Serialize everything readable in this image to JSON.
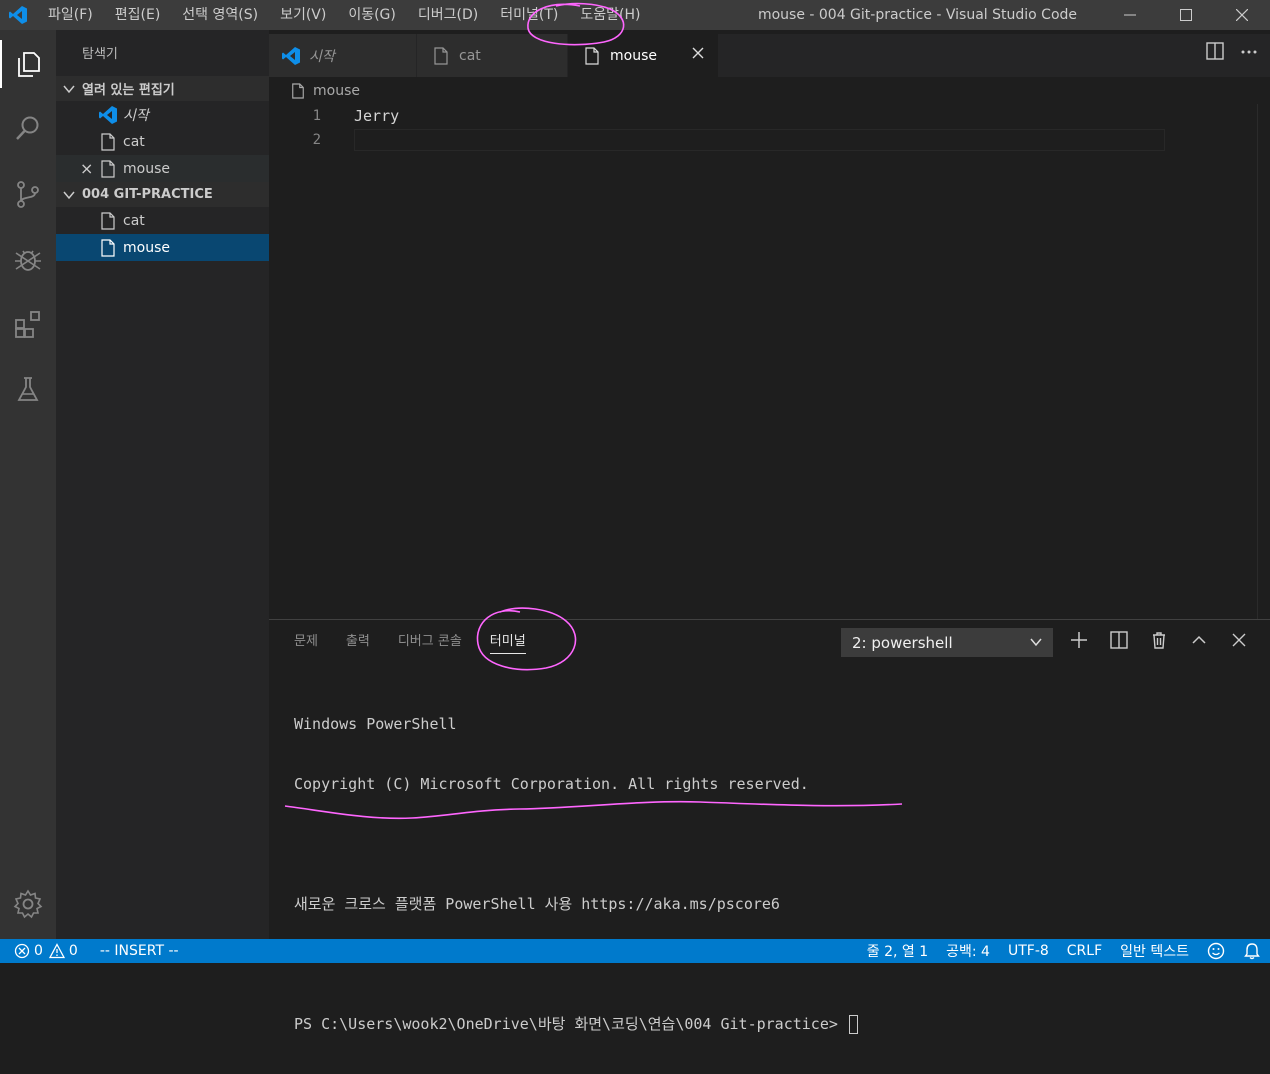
{
  "window": {
    "title": "mouse - 004 Git-practice - Visual Studio Code",
    "menu": [
      "파일(F)",
      "편집(E)",
      "선택 영역(S)",
      "보기(V)",
      "이동(G)",
      "디버그(D)",
      "터미널(T)",
      "도움말(H)"
    ]
  },
  "activitybar": {
    "icons": [
      "explorer-icon",
      "search-icon",
      "source-control-icon",
      "debug-icon",
      "extensions-icon",
      "test-flask-icon"
    ],
    "bottom_icon": "gear-icon"
  },
  "sidebar": {
    "title": "탐색기",
    "open_editors": {
      "header": "열려 있는 편집기",
      "items": [
        {
          "label": "시작",
          "icon": "vscode-icon"
        },
        {
          "label": "cat",
          "icon": "file-icon"
        },
        {
          "label": "mouse",
          "icon": "file-icon",
          "close": "×"
        }
      ]
    },
    "folder": {
      "header": "004 GIT-PRACTICE",
      "items": [
        {
          "label": "cat",
          "icon": "file-icon"
        },
        {
          "label": "mouse",
          "icon": "file-icon"
        }
      ]
    }
  },
  "tabs": [
    {
      "label": "시작",
      "icon": "vscode-icon"
    },
    {
      "label": "cat",
      "icon": "file-icon"
    },
    {
      "label": "mouse",
      "icon": "file-icon",
      "active": true
    }
  ],
  "breadcrumb": "mouse",
  "editor": {
    "lines": [
      {
        "num": "1",
        "text": "Jerry"
      },
      {
        "num": "2",
        "text": ""
      }
    ]
  },
  "panel": {
    "tabs": [
      "문제",
      "출력",
      "디버그 콘솔",
      "터미널"
    ],
    "active_tab": "터미널",
    "terminal_select": "2: powershell",
    "terminal_lines": [
      "Windows PowerShell",
      "Copyright (C) Microsoft Corporation. All rights reserved.",
      "",
      "새로운 크로스 플랫폼 PowerShell 사용 https://aka.ms/pscore6",
      "",
      "PS C:\\Users\\wook2\\OneDrive\\바탕 화면\\코딩\\연습\\004 Git-practice> "
    ]
  },
  "statusbar": {
    "errors": "0",
    "warnings": "0",
    "mode": "-- INSERT --",
    "position": "줄 2, 열 1",
    "spaces": "공백: 4",
    "encoding": "UTF-8",
    "eol": "CRLF",
    "language": "일반 텍스트"
  },
  "colors": {
    "statusbar": "#007acc",
    "titlebar": "#3c3c3c",
    "annotation": "#ff66ff",
    "selection": "#094771"
  }
}
